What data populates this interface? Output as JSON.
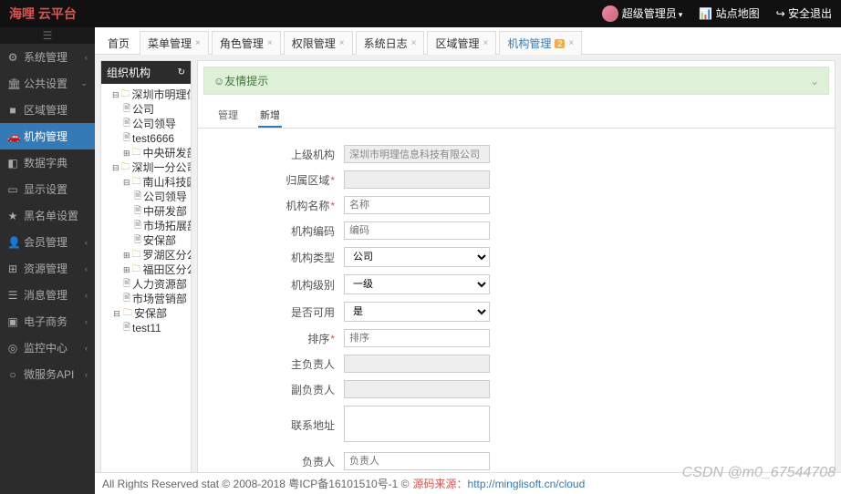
{
  "brand": {
    "logo": "海哩 云平台"
  },
  "header": {
    "user": "超级管理员",
    "sitemap": "站点地图",
    "logout": "安全退出"
  },
  "sidebar": {
    "items": [
      {
        "icon": "⚙",
        "label": "系统管理",
        "chev": "‹"
      },
      {
        "icon": "🏛",
        "label": "公共设置",
        "chev": "⌄"
      },
      {
        "icon": "■",
        "label": "区域管理",
        "sub": true
      },
      {
        "icon": "🚗",
        "label": "机构管理",
        "sub": true,
        "active": true
      },
      {
        "icon": "◧",
        "label": "数据字典",
        "sub": true
      },
      {
        "icon": "▭",
        "label": "显示设置",
        "sub": true
      },
      {
        "icon": "★",
        "label": "黑名单设置",
        "sub": true
      },
      {
        "icon": "👤",
        "label": "会员管理",
        "chev": "‹"
      },
      {
        "icon": "⊞",
        "label": "资源管理",
        "chev": "‹"
      },
      {
        "icon": "☰",
        "label": "消息管理",
        "chev": "‹"
      },
      {
        "icon": "▣",
        "label": "电子商务",
        "chev": "‹"
      },
      {
        "icon": "◎",
        "label": "监控中心",
        "chev": "‹"
      },
      {
        "icon": "○",
        "label": "微服务API",
        "chev": "‹"
      }
    ]
  },
  "tabs": [
    {
      "label": "首页",
      "home": true
    },
    {
      "label": "菜单管理",
      "close": true
    },
    {
      "label": "角色管理",
      "close": true
    },
    {
      "label": "权限管理",
      "close": true
    },
    {
      "label": "系统日志",
      "close": true
    },
    {
      "label": "区域管理",
      "close": true
    },
    {
      "label": "机构管理",
      "close": true,
      "active": true,
      "badge": "2"
    }
  ],
  "tree": {
    "title": "组织机构",
    "root": "深圳市明理信息科技有限公司",
    "nodes": [
      {
        "pad": 10,
        "tog": "⊟",
        "fold": true,
        "label": "深圳市明理信息科技有限公司"
      },
      {
        "pad": 22,
        "page": true,
        "label": "公司"
      },
      {
        "pad": 22,
        "page": true,
        "label": "公司领导"
      },
      {
        "pad": 22,
        "page": true,
        "label": "test6666"
      },
      {
        "pad": 22,
        "tog": "⊞",
        "fold": true,
        "label": "中央研发部"
      },
      {
        "pad": 10,
        "tog": "⊟",
        "fold": true,
        "label": "深圳一分公司"
      },
      {
        "pad": 22,
        "tog": "⊟",
        "fold": true,
        "label": "南山科技园分公司"
      },
      {
        "pad": 34,
        "page": true,
        "label": "公司领导"
      },
      {
        "pad": 34,
        "page": true,
        "label": "中研发部"
      },
      {
        "pad": 34,
        "page": true,
        "label": "市场拓展部"
      },
      {
        "pad": 34,
        "page": true,
        "label": "安保部"
      },
      {
        "pad": 22,
        "tog": "⊞",
        "fold": true,
        "label": "罗湖区分公司"
      },
      {
        "pad": 22,
        "tog": "⊞",
        "fold": true,
        "label": "福田区分公司"
      },
      {
        "pad": 22,
        "page": true,
        "label": "人力资源部"
      },
      {
        "pad": 22,
        "page": true,
        "label": "市场营销部"
      },
      {
        "pad": 10,
        "tog": "⊟",
        "fold": true,
        "label": "安保部"
      },
      {
        "pad": 22,
        "page": true,
        "label": "test11"
      }
    ]
  },
  "alert": {
    "title": "友情提示"
  },
  "subtabs": [
    {
      "label": "管理"
    },
    {
      "label": "新增",
      "active": true
    }
  ],
  "form": {
    "parent": {
      "label": "上级机构",
      "value": "深圳市明理信息科技有限公司"
    },
    "area": {
      "label": "归属区域",
      "req": true
    },
    "name": {
      "label": "机构名称",
      "req": true,
      "placeholder": "名称"
    },
    "code": {
      "label": "机构编码",
      "placeholder": "编码"
    },
    "type": {
      "label": "机构类型",
      "value": "公司"
    },
    "level": {
      "label": "机构级别",
      "value": "一级"
    },
    "enabled": {
      "label": "是否可用",
      "value": "是"
    },
    "sort": {
      "label": "排序",
      "req": true,
      "placeholder": "排序"
    },
    "primary": {
      "label": "主负责人"
    },
    "secondary": {
      "label": "副负责人"
    },
    "address": {
      "label": "联系地址"
    },
    "manager": {
      "label": "负责人",
      "placeholder": "负责人"
    }
  },
  "footer": {
    "copyright": "All Rights Reserved stat © 2008-2018 粤ICP备16101510号-1 © ",
    "src_label": "源码来源：",
    "src_url": "http://minglisoft.cn/cloud"
  },
  "watermark": "CSDN @m0_67544708"
}
